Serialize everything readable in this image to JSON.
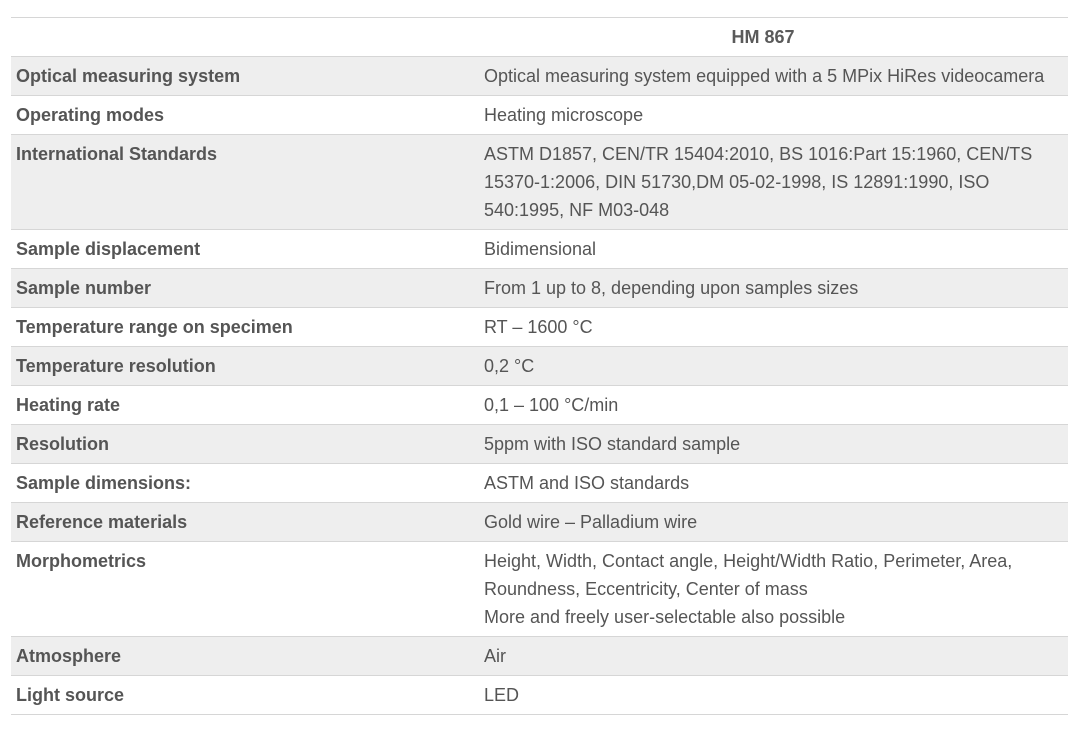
{
  "table": {
    "header": {
      "label": "",
      "model": "HM 867"
    },
    "rows": [
      {
        "label": "Optical measuring system",
        "value": [
          "Optical measuring system equipped with a 5 MPix HiRes videocamera"
        ]
      },
      {
        "label": "Operating modes",
        "value": [
          "Heating microscope"
        ]
      },
      {
        "label": "International Standards",
        "value": [
          "ASTM D1857, CEN/TR 15404:2010, BS 1016:Part 15:1960, CEN/TS 15370-1:2006, DIN 51730,DM 05-02-1998, IS 12891:1990, ISO 540:1995, NF M03-048"
        ]
      },
      {
        "label": "Sample displacement",
        "value": [
          "Bidimensional"
        ]
      },
      {
        "label": "Sample number",
        "value": [
          "From 1 up to 8, depending upon samples sizes"
        ]
      },
      {
        "label": "Temperature range on specimen",
        "value": [
          "RT – 1600 °C"
        ]
      },
      {
        "label": "Temperature resolution",
        "value": [
          "0,2 °C"
        ]
      },
      {
        "label": "Heating rate",
        "value": [
          "0,1 – 100 °C/min"
        ]
      },
      {
        "label": "Resolution",
        "value": [
          "5ppm with ISO standard sample"
        ]
      },
      {
        "label": "Sample dimensions:",
        "value": [
          "ASTM and ISO standards"
        ]
      },
      {
        "label": "Reference materials",
        "value": [
          "Gold wire – Palladium wire"
        ]
      },
      {
        "label": "Morphometrics",
        "value": [
          "Height, Width, Contact angle, Height/Width Ratio, Perimeter, Area, Roundness, Eccentricity, Center of mass",
          "More and freely user-selectable also possible"
        ]
      },
      {
        "label": "Atmosphere",
        "value": [
          "Air"
        ]
      },
      {
        "label": "Light source",
        "value": [
          "LED"
        ]
      }
    ]
  }
}
